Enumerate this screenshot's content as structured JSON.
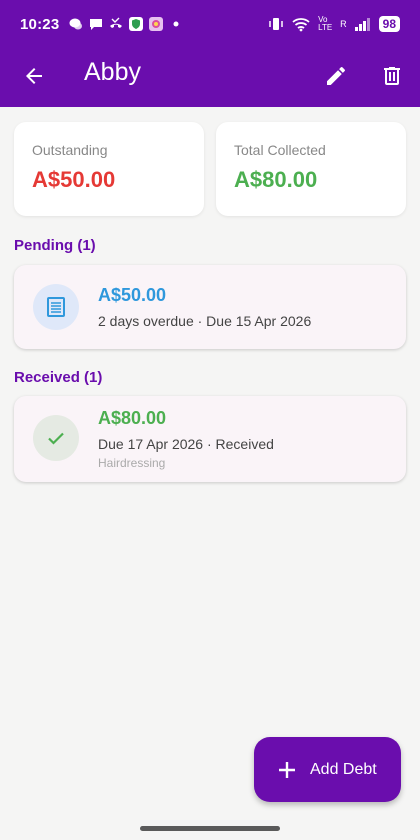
{
  "status_bar": {
    "time": "10:23",
    "battery": "98",
    "network": "Vo LTE",
    "signal_label": "R"
  },
  "app_bar": {
    "title": "Abby",
    "back_icon": "arrow-left-icon",
    "edit_icon": "pencil-icon",
    "delete_icon": "trash-icon"
  },
  "summary": {
    "outstanding": {
      "label": "Outstanding",
      "value": "A$50.00",
      "color": "#e53935"
    },
    "collected": {
      "label": "Total Collected",
      "value": "A$80.00",
      "color": "#4caf50"
    }
  },
  "sections": {
    "pending": {
      "title": "Pending (1)",
      "items": [
        {
          "amount": "A$50.00",
          "meta": "2 days overdue · Due 15 Apr 2026",
          "icon": "receipt-icon"
        }
      ]
    },
    "received": {
      "title": "Received (1)",
      "items": [
        {
          "amount": "A$80.00",
          "meta": "Due 17 Apr 2026 · Received",
          "note": "Hairdressing",
          "icon": "check-icon"
        }
      ]
    }
  },
  "fab": {
    "label": "Add Debt",
    "icon": "plus-icon"
  },
  "colors": {
    "primary": "#6a0dad",
    "pending_amount": "#2f98dc",
    "received_amount": "#4caf50"
  }
}
